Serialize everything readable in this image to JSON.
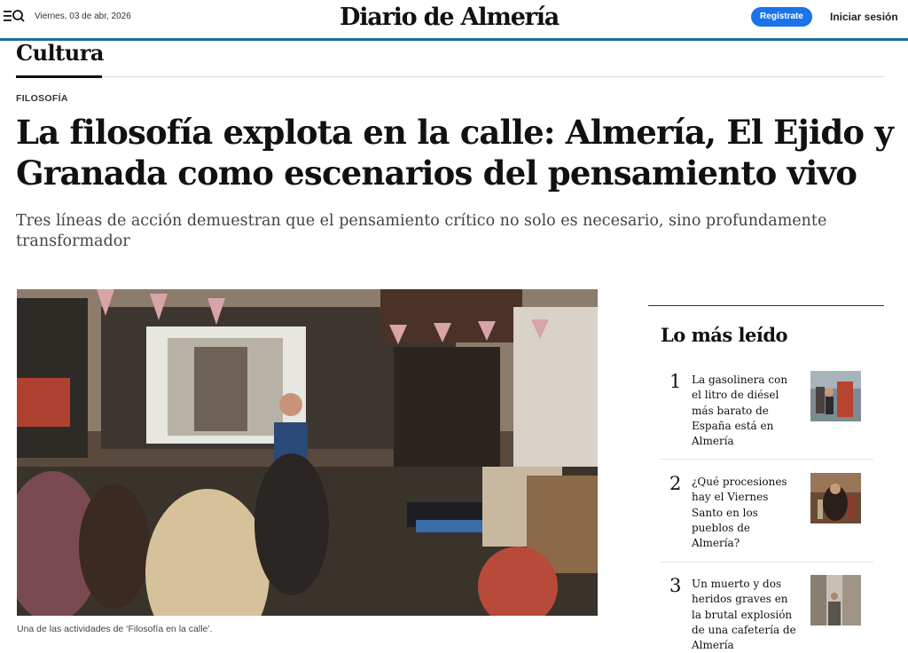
{
  "header": {
    "date": "Viernes, 03 de abr, 2026",
    "logo": "Diario de Almería",
    "register_label": "Regístrate",
    "login_label": "Iniciar sesión",
    "accent_color": "#1c6f9c",
    "button_color": "#1a73e8",
    "menu_icon": "menu-search-icon"
  },
  "section": {
    "title": "Cultura"
  },
  "article": {
    "kicker": "FILOSOFÍA",
    "headline": "La filosofía explota en la calle: Almería, El Ejido y Granada como escenarios del pensamiento vivo",
    "subtitle": "Tres líneas de acción demuestran que el pensamiento crítico no solo es necesario, sino profundamente transformador",
    "caption": "Una de las actividades de ‘Filosofía en la calle’."
  },
  "sidebar": {
    "title": "Lo más leído",
    "items": [
      {
        "num": "1",
        "text": "La gasolinera con el litro de diésel más barato de España está en Almería"
      },
      {
        "num": "2",
        "text": "¿Qué procesiones hay el Viernes Santo en los pueblos de Almería?"
      },
      {
        "num": "3",
        "text": "Un muerto y dos heridos graves en la brutal explosión de una cafetería de Almería"
      }
    ]
  }
}
